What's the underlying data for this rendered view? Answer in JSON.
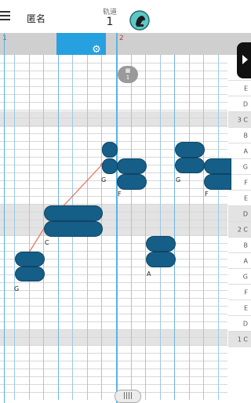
{
  "header": {
    "title": "匿名",
    "track_label": "轨道",
    "track_number": "1",
    "instrument_icon": "instrument-avatar-icon"
  },
  "ruler": {
    "bar1": "1",
    "bar2": "2"
  },
  "badge": {
    "line1": "▦",
    "line2": "1"
  },
  "keyboard": {
    "keys": [
      "E",
      "D",
      "3 C",
      "B",
      "A",
      "G",
      "F",
      "E",
      "D",
      "2 C",
      "B",
      "A",
      "G",
      "F",
      "E",
      "D",
      "1 C"
    ]
  },
  "notes": {
    "labels": [
      "G",
      "C",
      "G",
      "F",
      "A",
      "G",
      "F"
    ]
  },
  "scroll_handle": "||||",
  "colors": {
    "accent": "#27a0e0",
    "note": "#155e88",
    "band": "#e3e3e3",
    "connector": "#e8705a"
  }
}
